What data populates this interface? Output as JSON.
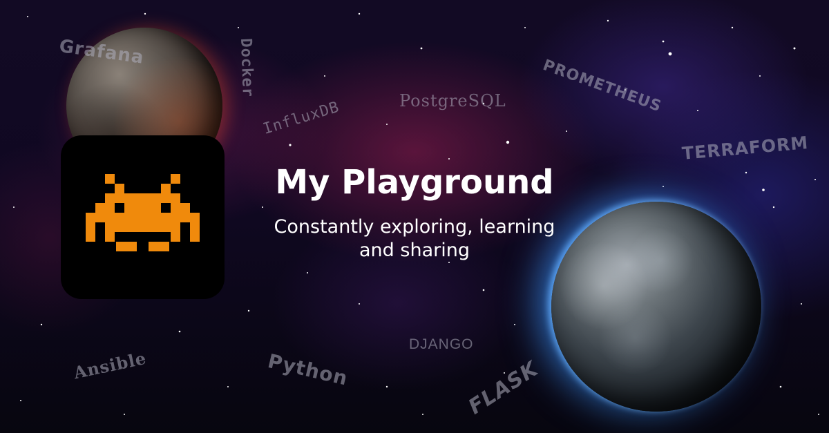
{
  "hero": {
    "title": "My Playground",
    "subtitle_line1": "Constantly exploring, learning",
    "subtitle_line2": "and sharing"
  },
  "tech_labels": {
    "grafana": "Grafana",
    "docker": "Docker",
    "influxdb": "InfluxDB",
    "postgresql": "PostgreSQL",
    "prometheus": "PROMETHEUS",
    "terraform": "TERRAFORM",
    "ansible": "Ansible",
    "python": "Python",
    "django": "DJANGO",
    "flask": "FLASK"
  },
  "icons": {
    "app_icon": "space-invader-icon"
  },
  "colors": {
    "invader": "#f08a0c",
    "icon_background": "#000000",
    "title_text": "#ffffff"
  }
}
